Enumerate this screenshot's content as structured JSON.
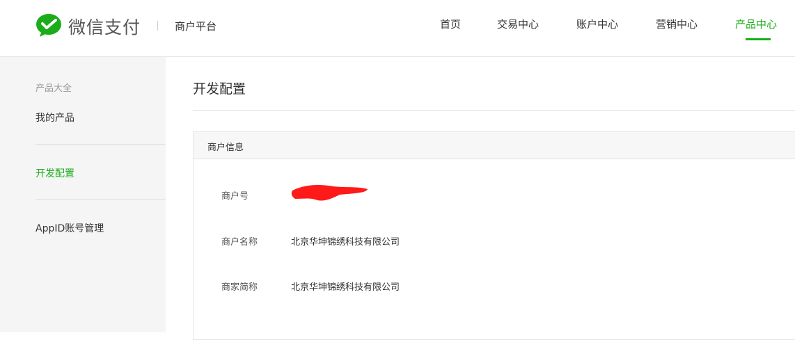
{
  "header": {
    "brand": "微信支付",
    "platform": "商户平台",
    "nav": [
      "首页",
      "交易中心",
      "账户中心",
      "营销中心",
      "产品中心"
    ],
    "active_nav": "产品中心",
    "accent_color": "#1aad19"
  },
  "sidebar": {
    "heading": "产品大全",
    "items": [
      "我的产品",
      "开发配置",
      "AppID账号管理"
    ],
    "active_item": "开发配置"
  },
  "main": {
    "title": "开发配置",
    "panel": {
      "header": "商户信息",
      "rows": [
        {
          "label": "商户号",
          "value": "",
          "redacted": true
        },
        {
          "label": "商户名称",
          "value": "北京华坤锦绣科技有限公司"
        },
        {
          "label": "商家简称",
          "value": "北京华坤锦绣科技有限公司"
        }
      ]
    }
  }
}
